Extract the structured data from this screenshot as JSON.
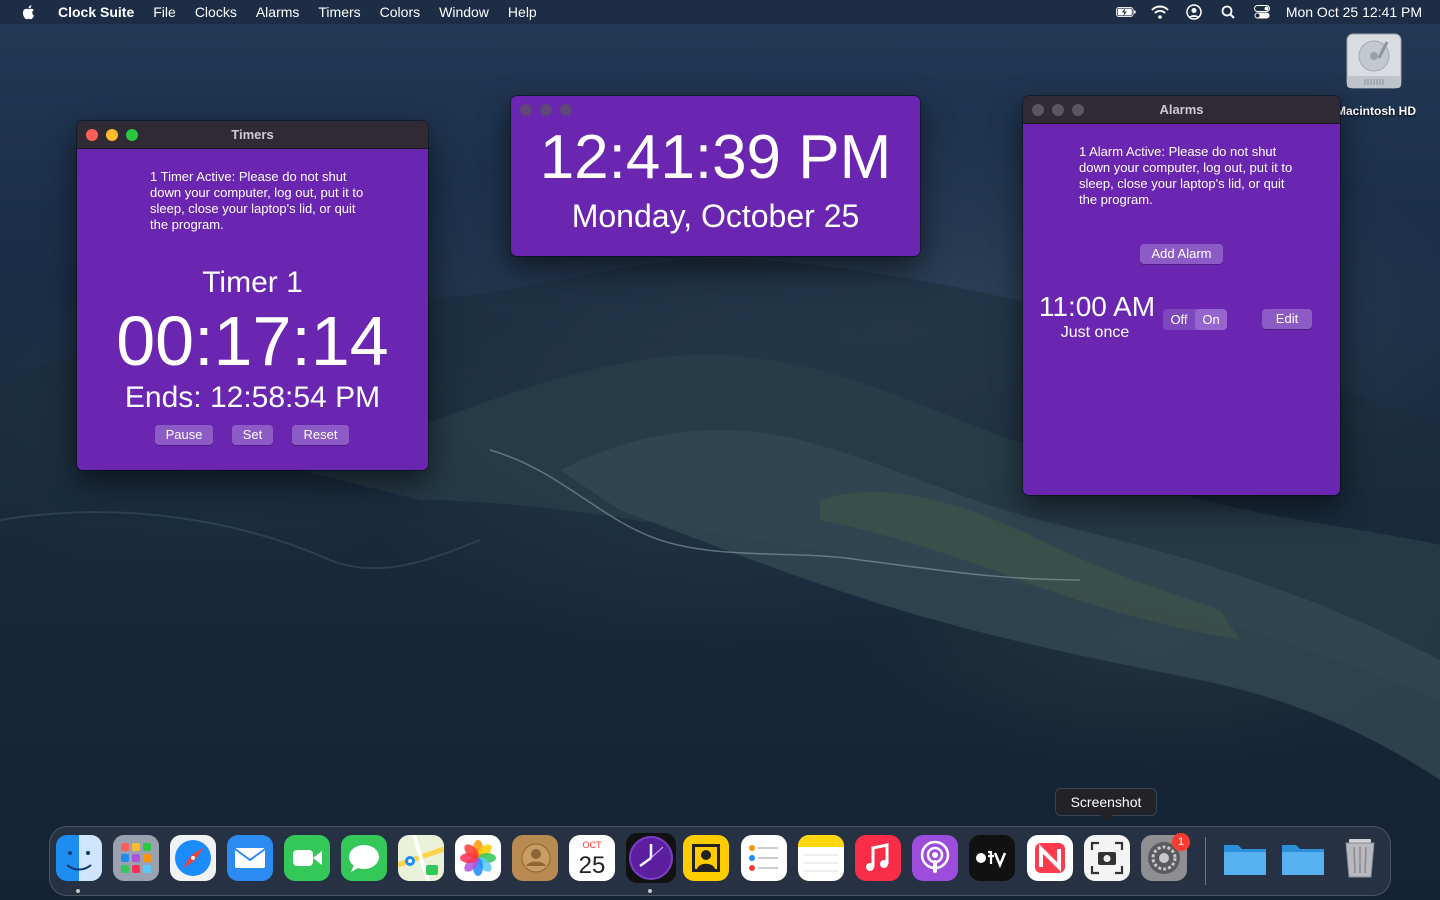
{
  "menubar": {
    "app_name": "Clock Suite",
    "items": [
      "File",
      "Clocks",
      "Alarms",
      "Timers",
      "Colors",
      "Window",
      "Help"
    ],
    "status_icons": [
      "battery-charging-icon",
      "wifi-icon",
      "user-icon",
      "spotlight-search-icon",
      "control-center-icon"
    ],
    "datetime": "Mon Oct 25  12:41 PM"
  },
  "desktop": {
    "hd_label": "Macintosh HD"
  },
  "timers_window": {
    "title": "Timers",
    "message": "1 Timer Active: Please do not shut down your computer, log out, put it to sleep, close your laptop's lid, or quit the program.",
    "timer_name": "Timer 1",
    "timer_value": "00:17:14",
    "ends": "Ends: 12:58:54 PM",
    "buttons": {
      "pause": "Pause",
      "set": "Set",
      "reset": "Reset"
    }
  },
  "clock_window": {
    "time": "12:41:39 PM",
    "date": "Monday, October 25"
  },
  "alarms_window": {
    "title": "Alarms",
    "message": "1 Alarm Active: Please do not shut down your computer, log out, put it to sleep, close your laptop's lid, or quit the program.",
    "add_label": "Add Alarm",
    "alarm": {
      "time": "11:00 AM",
      "repeat": "Just once",
      "toggle": {
        "off": "Off",
        "on": "On",
        "selected": "On"
      },
      "edit_label": "Edit"
    }
  },
  "dock": {
    "tooltip": "Screenshot",
    "calendar_month": "OCT",
    "calendar_day": "25",
    "settings_badge": "1",
    "apps": [
      "finder-icon",
      "launchpad-icon",
      "safari-icon",
      "mail-icon",
      "facetime-icon",
      "messages-icon",
      "maps-icon",
      "photos-icon",
      "contacts-icon",
      "calendar-icon",
      "clock-suite-icon",
      "photo-booth-icon",
      "reminders-icon",
      "notes-icon",
      "music-icon",
      "podcasts-icon",
      "apple-tv-icon",
      "news-icon",
      "screenshot-icon",
      "system-preferences-icon",
      "downloads-folder-icon",
      "documents-folder-icon",
      "trash-icon"
    ]
  },
  "colors": {
    "window_purple": "#6a26b0",
    "button_purple": "#8d5bc6",
    "titlebar": "#2f2a33"
  }
}
